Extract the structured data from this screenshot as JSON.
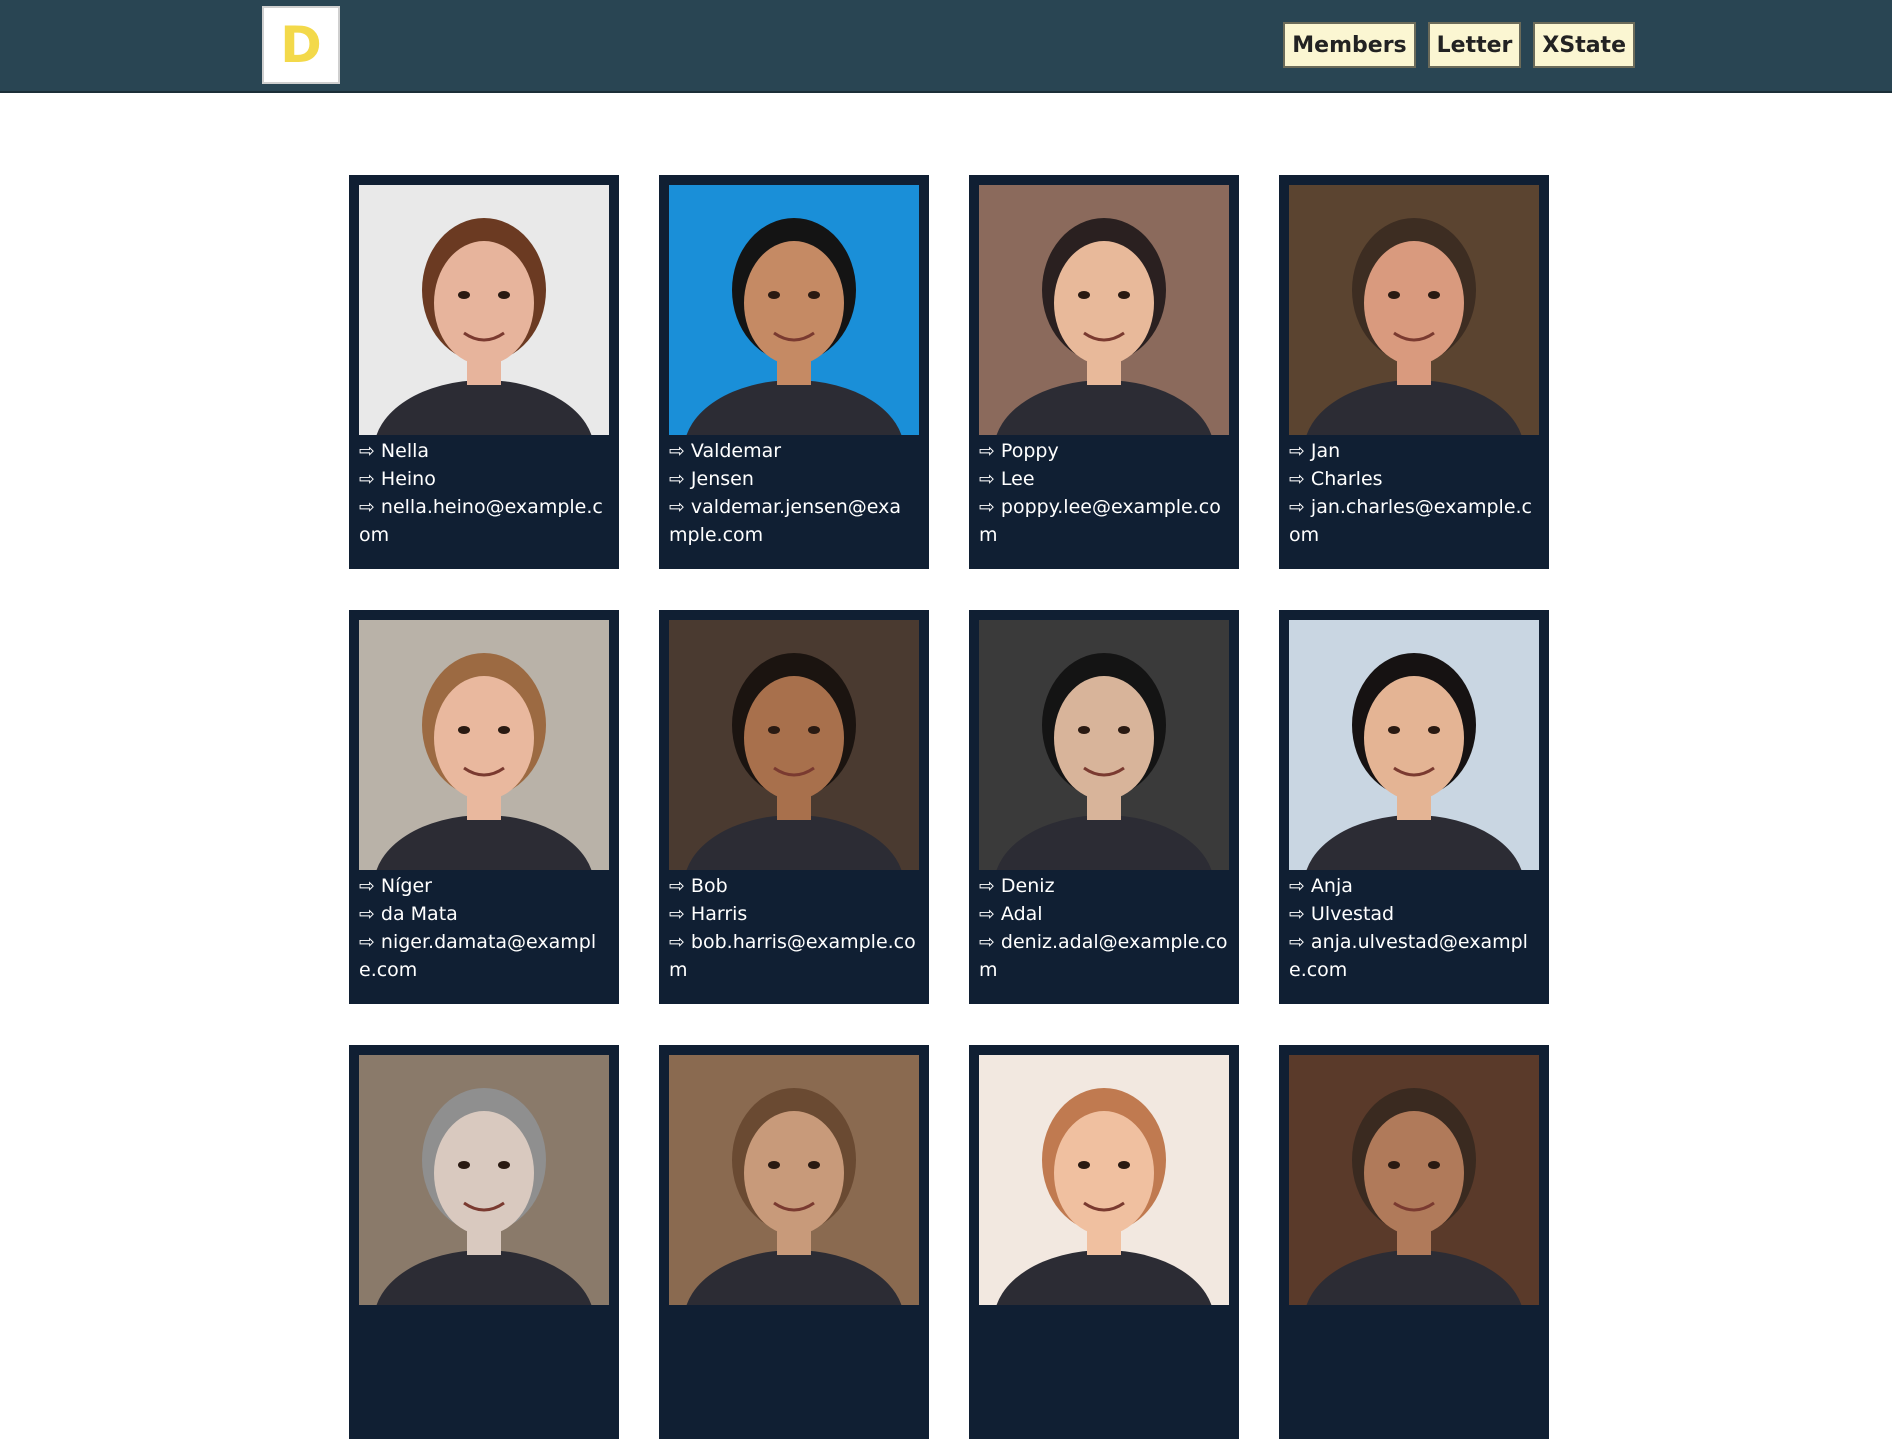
{
  "header": {
    "logo_letter": "D",
    "nav": [
      "Members",
      "Letter",
      "XState"
    ],
    "bg_color": "#294553",
    "button_color": "#fbf6d2",
    "logo_color": "#f3d94a"
  },
  "arrow": "⇨",
  "members": [
    {
      "first": "Nella",
      "last": "Heino",
      "email": "nella.heino@example.com",
      "skin": "#e7b49c",
      "hair": "#6b3a22",
      "bg": "#e9e9e9"
    },
    {
      "first": "Valdemar",
      "last": "Jensen",
      "email": "valdemar.jensen@example.com",
      "skin": "#c58a64",
      "hair": "#141414",
      "bg": "#1a8fd8"
    },
    {
      "first": "Poppy",
      "last": "Lee",
      "email": "poppy.lee@example.com",
      "skin": "#e8b99a",
      "hair": "#2a2020",
      "bg": "#8b6a5c"
    },
    {
      "first": "Jan",
      "last": "Charles",
      "email": "jan.charles@example.com",
      "skin": "#d99a7e",
      "hair": "#3d2d22",
      "bg": "#5b4430"
    },
    {
      "first": "Níger",
      "last": "da Mata",
      "email": "niger.damata@example.com",
      "skin": "#e9b89e",
      "hair": "#9c6a42",
      "bg": "#b9b2a8"
    },
    {
      "first": "Bob",
      "last": "Harris",
      "email": "bob.harris@example.com",
      "skin": "#a8704c",
      "hair": "#1b1410",
      "bg": "#4a3a30"
    },
    {
      "first": "Deniz",
      "last": "Adal",
      "email": "deniz.adal@example.com",
      "skin": "#d8b49a",
      "hair": "#141414",
      "bg": "#3a3a3a"
    },
    {
      "first": "Anja",
      "last": "Ulvestad",
      "email": "anja.ulvestad@example.com",
      "skin": "#e4b494",
      "hair": "#161212",
      "bg": "#c9d6e2"
    },
    {
      "first": "",
      "last": "",
      "email": "",
      "skin": "#d9c9bf",
      "hair": "#8f8f8f",
      "bg": "#8a7a6a"
    },
    {
      "first": "",
      "last": "",
      "email": "",
      "skin": "#c89a7a",
      "hair": "#6a4a32",
      "bg": "#8a6a50"
    },
    {
      "first": "",
      "last": "",
      "email": "",
      "skin": "#f0c0a0",
      "hair": "#c07a50",
      "bg": "#f2e8e0"
    },
    {
      "first": "",
      "last": "",
      "email": "",
      "skin": "#b07a5a",
      "hair": "#3a2a20",
      "bg": "#5a3a2a"
    }
  ]
}
